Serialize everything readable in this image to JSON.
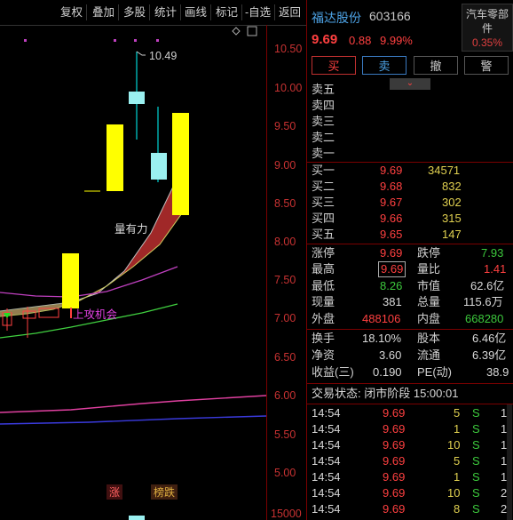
{
  "toolbar": {
    "items": [
      "复权",
      "叠加",
      "多股",
      "统计",
      "画线",
      "标记",
      "-自选",
      "返回"
    ]
  },
  "chart": {
    "price_ticks": [
      "10.50",
      "10.00",
      "9.50",
      "9.00",
      "8.50",
      "8.00",
      "7.50",
      "7.00",
      "6.50",
      "6.00",
      "5.50",
      "5.00"
    ],
    "high_label": "10.49",
    "annotation_strong": "量有力",
    "annotation_attack": "上攻机会",
    "badge_rise": "涨",
    "badge_list": "榜跌",
    "volume_label": "15000"
  },
  "quote": {
    "name": "福达股份",
    "code": "603166",
    "sector_line1": "汽车零部",
    "sector_line2": "件",
    "sector_pct": "0.35%",
    "price": "9.69",
    "change": "0.88",
    "change_pct": "9.99%",
    "buttons": {
      "buy": "买",
      "sell": "卖",
      "cancel": "撤",
      "alert": "警"
    },
    "asks": [
      {
        "label": "卖五",
        "price": "",
        "vol": ""
      },
      {
        "label": "卖四",
        "price": "",
        "vol": ""
      },
      {
        "label": "卖三",
        "price": "",
        "vol": ""
      },
      {
        "label": "卖二",
        "price": "",
        "vol": ""
      },
      {
        "label": "卖一",
        "price": "",
        "vol": ""
      }
    ],
    "bids": [
      {
        "label": "买一",
        "price": "9.69",
        "vol": "34571"
      },
      {
        "label": "买二",
        "price": "9.68",
        "vol": "832"
      },
      {
        "label": "买三",
        "price": "9.67",
        "vol": "302"
      },
      {
        "label": "买四",
        "price": "9.66",
        "vol": "315"
      },
      {
        "label": "买五",
        "price": "9.65",
        "vol": "147"
      }
    ],
    "stats": [
      {
        "l1": "涨停",
        "v1": "9.69",
        "c1": "red",
        "l2": "跌停",
        "v2": "7.93",
        "c2": "green"
      },
      {
        "l1": "最高",
        "v1": "9.69",
        "c1": "red",
        "l2": "量比",
        "v2": "1.41",
        "c2": "red"
      },
      {
        "l1": "最低",
        "v1": "8.26",
        "c1": "green",
        "l2": "市值",
        "v2": "62.6亿",
        "c2": "white"
      },
      {
        "l1": "现量",
        "v1": "381",
        "c1": "white",
        "l2": "总量",
        "v2": "115.6万",
        "c2": "white"
      },
      {
        "l1": "外盘",
        "v1": "488106",
        "c1": "red",
        "l2": "内盘",
        "v2": "668280",
        "c2": "green"
      }
    ],
    "stats2": [
      {
        "l1": "换手",
        "v1": "18.10%",
        "l2": "股本",
        "v2": "6.46亿"
      },
      {
        "l1": "净资",
        "v1": "3.60",
        "l2": "流通",
        "v2": "6.39亿"
      },
      {
        "l1": "收益(三)",
        "v1": "0.190",
        "l2": "PE(动)",
        "v2": "38.9"
      }
    ],
    "status": "交易状态: 闭市阶段 15:00:01",
    "ticks": [
      {
        "time": "14:54",
        "price": "9.69",
        "vol": "5",
        "side": "S",
        "n": "1"
      },
      {
        "time": "14:54",
        "price": "9.69",
        "vol": "1",
        "side": "S",
        "n": "1"
      },
      {
        "time": "14:54",
        "price": "9.69",
        "vol": "10",
        "side": "S",
        "n": "1"
      },
      {
        "time": "14:54",
        "price": "9.69",
        "vol": "5",
        "side": "S",
        "n": "1"
      },
      {
        "time": "14:54",
        "price": "9.69",
        "vol": "1",
        "side": "S",
        "n": "1"
      },
      {
        "time": "14:54",
        "price": "9.69",
        "vol": "10",
        "side": "S",
        "n": "2"
      },
      {
        "time": "14:54",
        "price": "9.69",
        "vol": "8",
        "side": "S",
        "n": "2"
      }
    ]
  },
  "colors": {
    "up": "#ff4040",
    "down": "#3cc83c",
    "candle_up": "#ffff00",
    "accent": "#4da3e6"
  }
}
